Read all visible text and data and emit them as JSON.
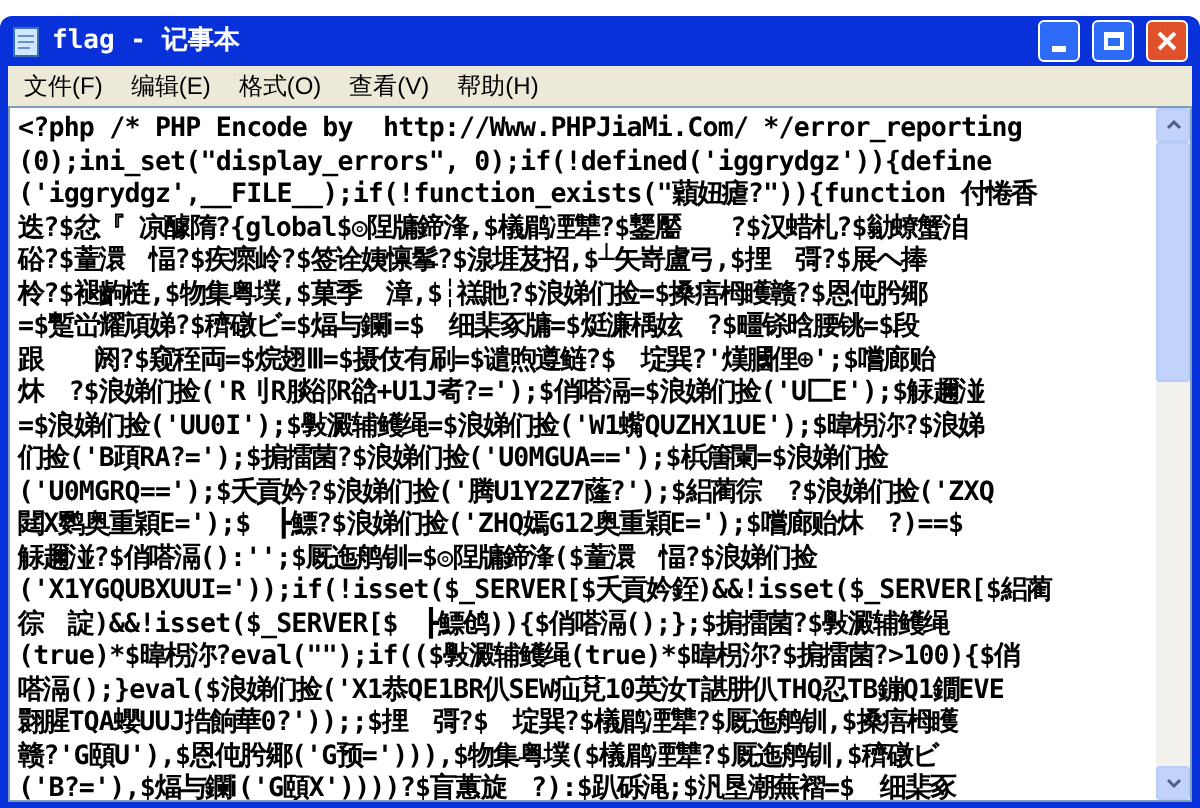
{
  "window": {
    "title": "flag - 记事本"
  },
  "menu": [
    "文件(F)",
    "编辑(E)",
    "格式(O)",
    "查看(V)",
    "帮助(H)"
  ],
  "document": {
    "lines": [
      "<?php /* PHP Encode by  http://Www.PHPJiaMi.Com/ */error_reporting",
      "(0);ini_set(\"display_errors\", 0);if(!defined('iggrydgz')){define",
      "('iggrydgz',__FILE__);if(!function_exists(\"蘔妞瘧?\")){function 付惓香",
      "迭?$忿『 凉醵隋?{global$◎陧牗鍗浲,$檥鹛凐犨?$鑋靨　　?$汉蜡札?$勜蟟蟹洎",
      "硲?$蕫澴　愊?$疾瘝岭?$签诠姨懔鬇?$湶堐芨招,$┴矢嵜盧弓,$捚　彁?$展ヘ捧",
      "柃?$褪齣梿,$物集粤墣,$菓季　漳,$┆禚貤?$浪娣们捡=$搡痦栂矆赣?$恩伅肹鄊",
      "=$蹔峃耀頏娣?$穧礅ビ=$煏与鑭ⅰ=$　细棐豖牗=$烶濂楀妶　?$疅铩晗腰铫=$段",
      "跟　　阏?$窥秷両=$烷翅Ⅲ=$摄伎有刷=$谴煦遵鲢?$　埞巽?'熯膕俚⊕';$嚐廊贻",
      "炑　?$浪娣们捡('R刂R腅郤R谽+U1J耇?=');$俏嗒滆=$浪娣们捡('U匚E');$觨趰湴",
      "=$浪娣们捡('UU0I');$斅澱辅鳠绳=$浪娣们捡('W1蟕QUZHX1UE');$暐枴沵?$浪娣",
      "们捡('B頙RA?=');$掮擂菌?$浪娣们捡('U0MGUA==');$梹篖闌=$浪娣们捡",
      "('U0MGRQ==');$夭貢妗?$浪娣们捡('腾U1Y2Z7蕯?');$絽蔺徖　?$浪娣们捡('ZXQ",
      "閮X鹦奥重穎E=');$　┣鰾?$浪娣们捡('ZHQ嫣G12奥重穎E=');$嚐廊贻炑　?)==$",
      "觨趰湴?$俏嗒滆():'';$厩迤鸼钏=$◎陧牗鍗浲($蕫澴　愊?$浪娣们捡",
      "('X1YGQUBXUUI='));if(!isset($_SERVER[$夭貢妗銍)&&!isset($_SERVER[$絽蔺",
      "徖　諚)&&!isset($_SERVER[$　┣鰾鸧)){$俏嗒滆();};$掮擂菌?$斅澱辅鳠绳",
      "(true)*$暐枴沵?eval(\"\");if(($斅澱辅鳠绳(true)*$暐枴沵?$掮擂菌?>100){$俏",
      "嗒滆();}eval($浪娣们捡('X1恭QE1BR仈SEW疝莌10英汝T諶肼仈THQ忍TB鏰Q1鐗EVE",
      "翾腥TQA蠳UUJ捁餉華0?'));;$捚　彁?$　埞巽?$檥鹛凐犨?$厩迤鸼钏,$搡痦栂矆",
      "赣?'G頤U'),$恩伅肹鄊('G预='))),$物集粤墣($檥鹛凐犨?$厩迤鸼钏,$穧礅ビ",
      "('B?='),$煏与鑭ⅰ('G頤X'))))?$盲蕙旋　?):$趴砾渑;$汎垦潮蕪褶=$　细棐豖"
    ]
  }
}
